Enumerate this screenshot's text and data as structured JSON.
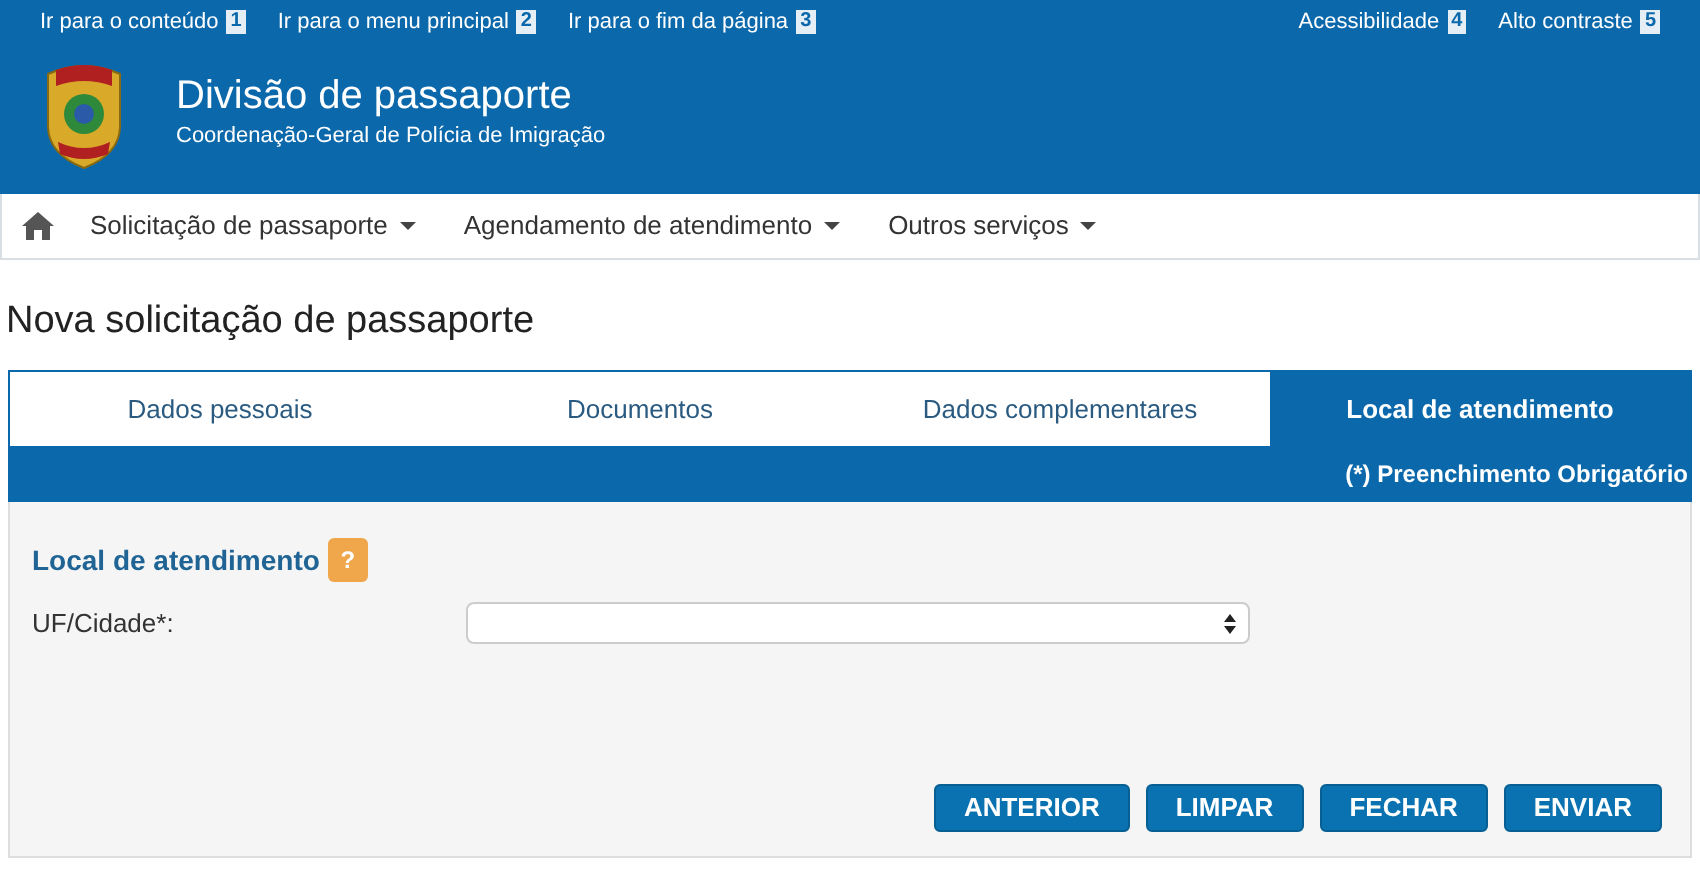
{
  "skip_links": [
    {
      "label": "Ir para o conteúdo",
      "key": "1"
    },
    {
      "label": "Ir para o menu principal",
      "key": "2"
    },
    {
      "label": "Ir para o fim da página",
      "key": "3"
    }
  ],
  "accessibility_links": [
    {
      "label": "Acessibilidade",
      "key": "4"
    },
    {
      "label": "Alto contraste",
      "key": "5"
    }
  ],
  "header": {
    "title": "Divisão de passaporte",
    "subtitle": "Coordenação-Geral de Polícia de Imigração"
  },
  "nav": [
    {
      "label": "Solicitação de passaporte",
      "dropdown": true
    },
    {
      "label": "Agendamento de atendimento",
      "dropdown": true
    },
    {
      "label": "Outros serviços",
      "dropdown": true
    }
  ],
  "page_title": "Nova solicitação de passaporte",
  "tabs": [
    {
      "label": "Dados pessoais",
      "selected": false
    },
    {
      "label": "Documentos",
      "selected": false
    },
    {
      "label": "Dados complementares",
      "selected": false
    },
    {
      "label": "Local de atendimento",
      "selected": true
    }
  ],
  "required_note": "(*) Preenchimento Obrigatório",
  "section": {
    "title": "Local de atendimento",
    "help": "?"
  },
  "fields": [
    {
      "label": "UF/Cidade*:",
      "kind": "select"
    }
  ],
  "buttons": [
    "ANTERIOR",
    "LIMPAR",
    "FECHAR",
    "ENVIAR"
  ]
}
